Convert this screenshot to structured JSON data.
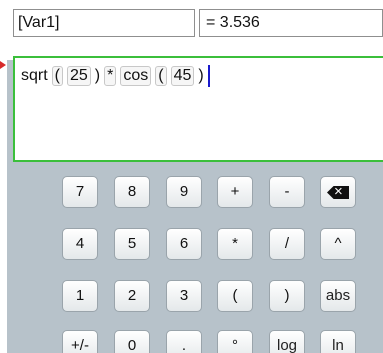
{
  "input": {
    "name_value": "[Var1]",
    "result_value": "= 3.536"
  },
  "editor": {
    "tokens": {
      "t1": "sqrt",
      "t2": "(",
      "t3": "25",
      "t4": ")",
      "t5": "*",
      "t6": "cos",
      "t7": "(",
      "t8": "45",
      "t9": ")"
    }
  },
  "keypad": {
    "r1": [
      "7",
      "8",
      "9",
      "+",
      "-",
      "⌫"
    ],
    "r2": [
      "4",
      "5",
      "6",
      "*",
      "/",
      "^"
    ],
    "r3": [
      "1",
      "2",
      "3",
      "(",
      ")",
      "abs"
    ],
    "r4": [
      "+/-",
      "0",
      ".",
      "°",
      "log",
      "ln"
    ]
  },
  "colors": {
    "editor_border": "#3bbf3b",
    "cursor": "#1a1acc",
    "arrow": "#d62a2a"
  },
  "icons": {
    "backspace": "backspace-icon"
  }
}
